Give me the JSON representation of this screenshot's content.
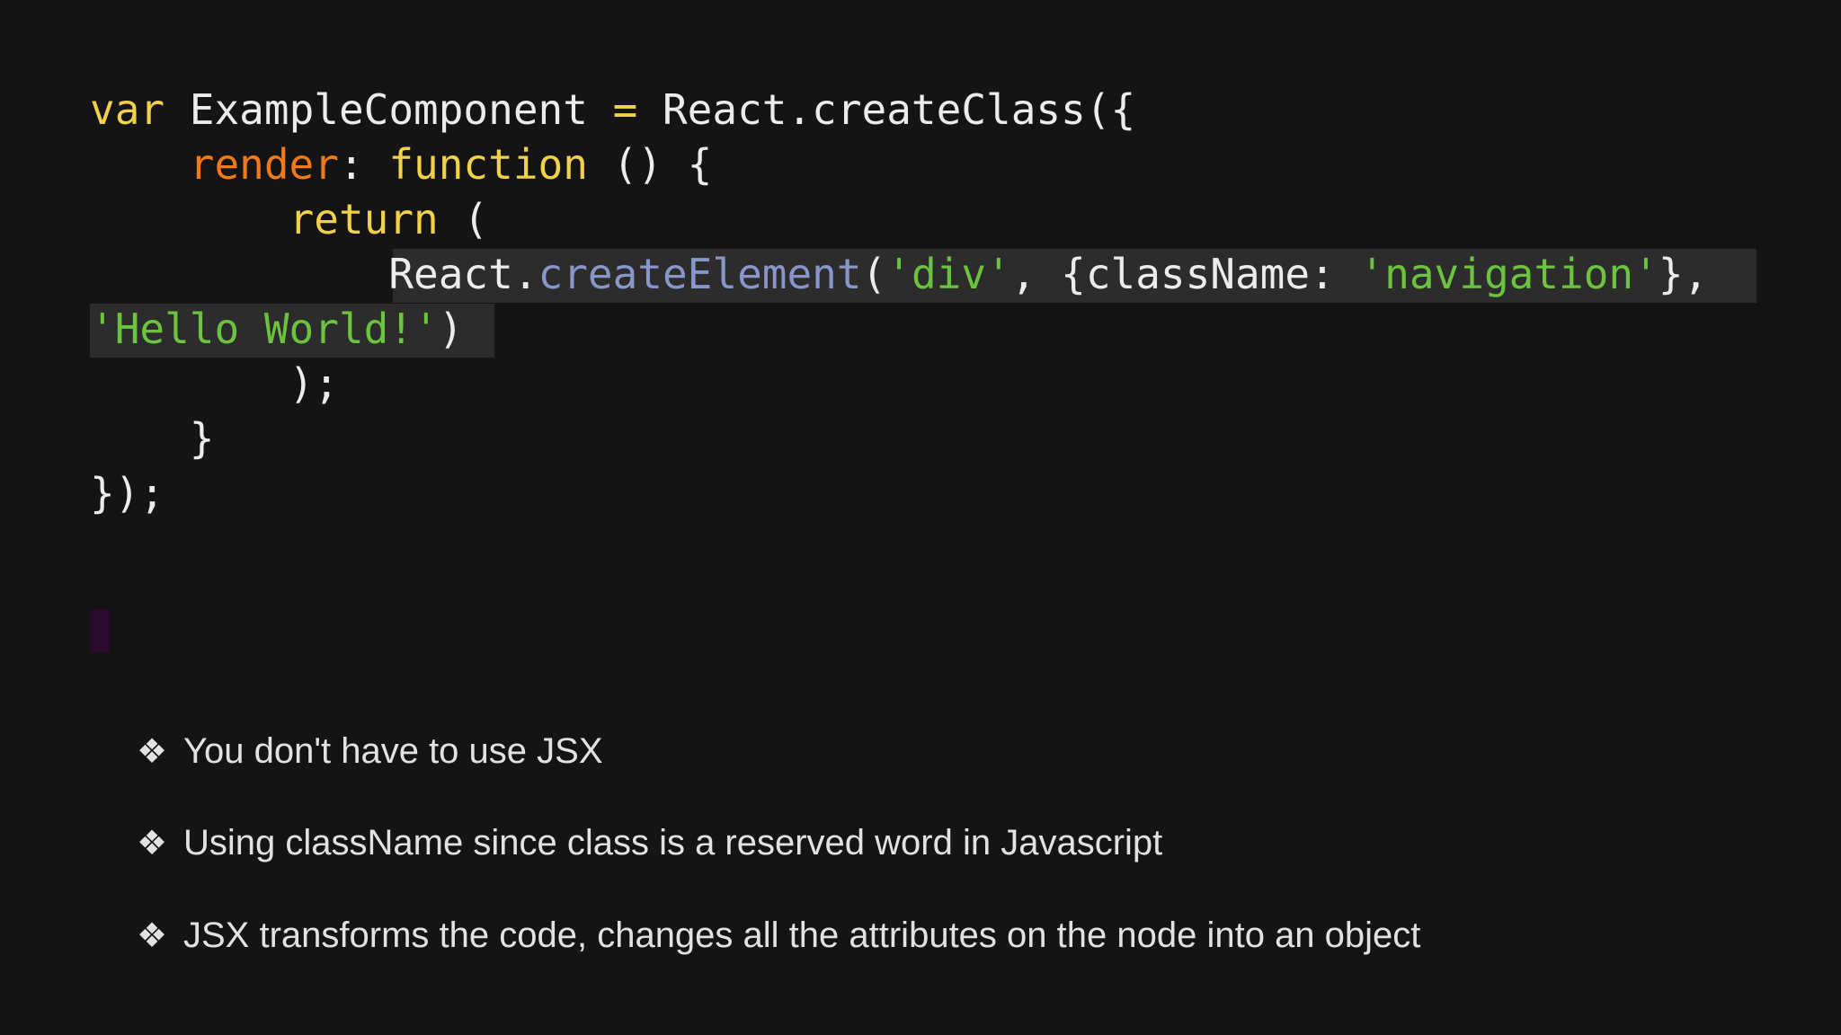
{
  "code": {
    "line1": {
      "kw_var": "var",
      "name": " ExampleComponent ",
      "eq": "=",
      "rest": " React.createClass({"
    },
    "line2": {
      "indent": "    ",
      "prop": "render",
      "colon": ": ",
      "kw_function": "function",
      "rest": " () {"
    },
    "line3": {
      "indent": "        ",
      "kw_return": "return",
      "rest": " ("
    },
    "line4": {
      "indent": "            ",
      "obj": "React.",
      "method": "createElement",
      "open": "(",
      "str_div": "'div'",
      "mid": ", {className: ",
      "str_nav": "'navigation'",
      "close": "},"
    },
    "line5": {
      "str_hello": "'Hello World!'",
      "close": ")"
    },
    "line6": {
      "text": "        );"
    },
    "line7": {
      "text": "    }"
    },
    "line8": {
      "text": "});"
    }
  },
  "bullets": [
    {
      "icon": "diamond-bullet-icon",
      "text": "You don't have to use JSX"
    },
    {
      "icon": "diamond-bullet-icon",
      "text": "Using className since class is a reserved word in Javascript"
    },
    {
      "icon": "diamond-bullet-icon",
      "text": "JSX transforms the code, changes all the attributes on the node into an object"
    }
  ],
  "bullet_glyph": "❖",
  "colors": {
    "background": "#141316",
    "keyword": "#f2d14a",
    "property": "#f07a16",
    "method": "#8896c9",
    "string": "#6cc43e",
    "text": "#ececec",
    "highlight": "#2c2c2c"
  }
}
